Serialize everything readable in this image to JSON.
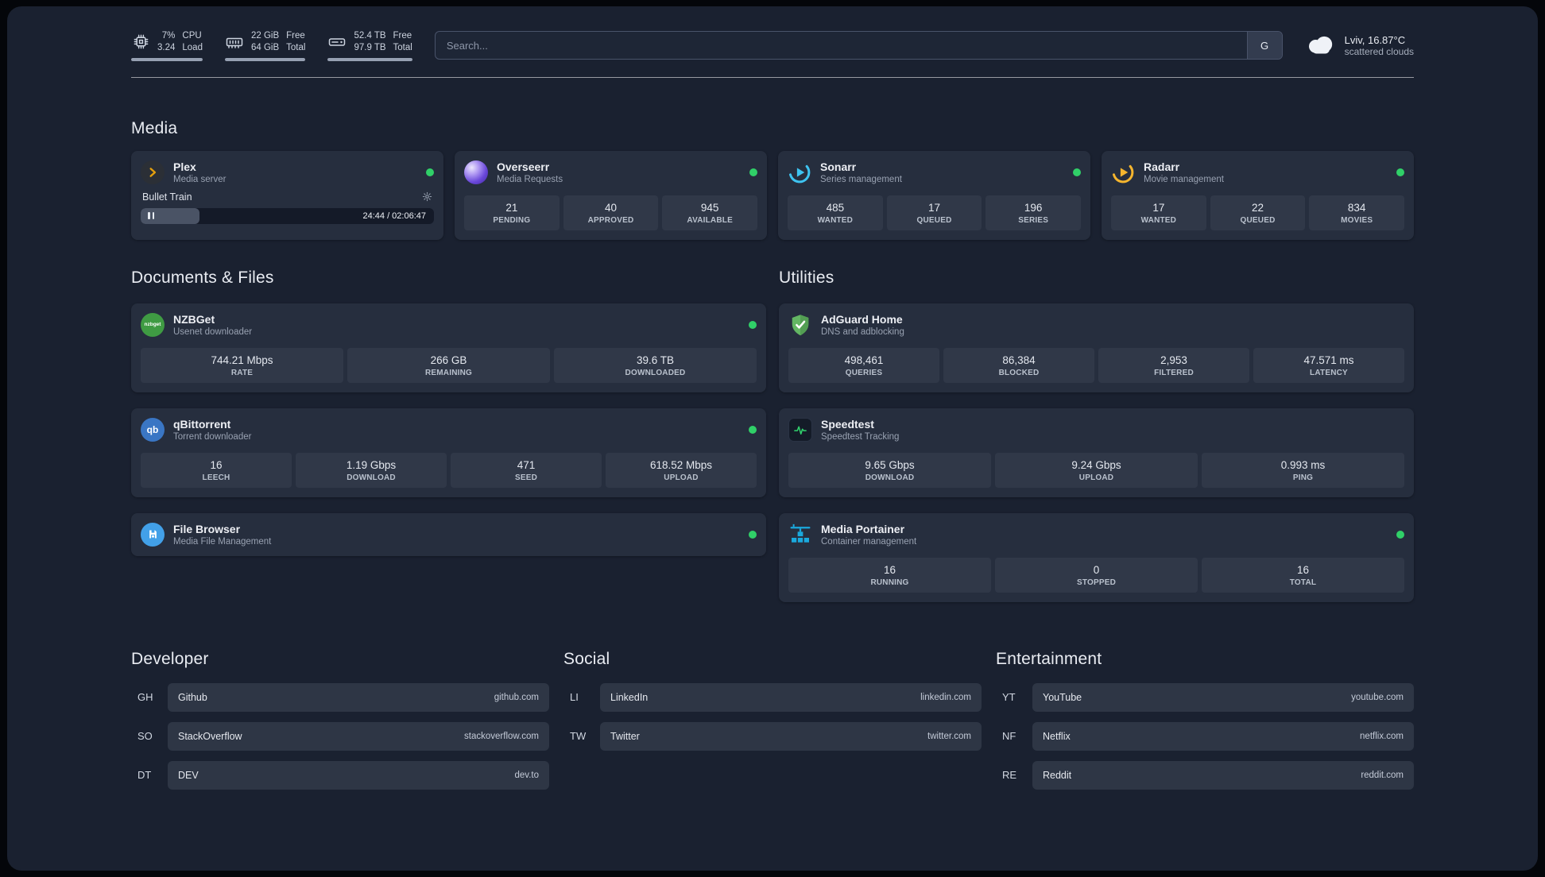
{
  "topbar": {
    "cpu": {
      "value1": "7%",
      "value2": "3.24",
      "label1": "CPU",
      "label2": "Load"
    },
    "memory": {
      "value1": "22 GiB",
      "value2": "64 GiB",
      "label1": "Free",
      "label2": "Total"
    },
    "disk": {
      "value1": "52.4 TB",
      "value2": "97.9 TB",
      "label1": "Free",
      "label2": "Total"
    },
    "search": {
      "placeholder": "Search...",
      "button_label": "G"
    },
    "weather": {
      "location": "Lviv, 16.87°C",
      "condition": "scattered clouds"
    }
  },
  "sections": {
    "media": {
      "heading": "Media",
      "plex": {
        "title": "Plex",
        "subtitle": "Media server",
        "now_playing": {
          "track": "Bullet Train",
          "time": "24:44 / 02:06:47"
        }
      },
      "overseerr": {
        "title": "Overseerr",
        "subtitle": "Media Requests",
        "stats": [
          {
            "value": "21",
            "label": "PENDING"
          },
          {
            "value": "40",
            "label": "APPROVED"
          },
          {
            "value": "945",
            "label": "AVAILABLE"
          }
        ]
      },
      "sonarr": {
        "title": "Sonarr",
        "subtitle": "Series management",
        "stats": [
          {
            "value": "485",
            "label": "WANTED"
          },
          {
            "value": "17",
            "label": "QUEUED"
          },
          {
            "value": "196",
            "label": "SERIES"
          }
        ]
      },
      "radarr": {
        "title": "Radarr",
        "subtitle": "Movie management",
        "stats": [
          {
            "value": "17",
            "label": "WANTED"
          },
          {
            "value": "22",
            "label": "QUEUED"
          },
          {
            "value": "834",
            "label": "MOVIES"
          }
        ]
      }
    },
    "docs": {
      "heading": "Documents & Files",
      "nzbget": {
        "title": "NZBGet",
        "subtitle": "Usenet downloader",
        "icon_text": "nzbget",
        "stats": [
          {
            "value": "744.21 Mbps",
            "label": "RATE"
          },
          {
            "value": "266 GB",
            "label": "REMAINING"
          },
          {
            "value": "39.6 TB",
            "label": "DOWNLOADED"
          }
        ]
      },
      "qbittorrent": {
        "title": "qBittorrent",
        "subtitle": "Torrent downloader",
        "icon_text": "qb",
        "stats": [
          {
            "value": "16",
            "label": "LEECH"
          },
          {
            "value": "1.19 Gbps",
            "label": "DOWNLOAD"
          },
          {
            "value": "471",
            "label": "SEED"
          },
          {
            "value": "618.52 Mbps",
            "label": "UPLOAD"
          }
        ]
      },
      "filebrowser": {
        "title": "File Browser",
        "subtitle": "Media File Management"
      }
    },
    "utils": {
      "heading": "Utilities",
      "adguard": {
        "title": "AdGuard Home",
        "subtitle": "DNS and adblocking",
        "stats": [
          {
            "value": "498,461",
            "label": "QUERIES"
          },
          {
            "value": "86,384",
            "label": "BLOCKED"
          },
          {
            "value": "2,953",
            "label": "FILTERED"
          },
          {
            "value": "47.571 ms",
            "label": "LATENCY"
          }
        ]
      },
      "speedtest": {
        "title": "Speedtest",
        "subtitle": "Speedtest Tracking",
        "stats": [
          {
            "value": "9.65 Gbps",
            "label": "DOWNLOAD"
          },
          {
            "value": "9.24 Gbps",
            "label": "UPLOAD"
          },
          {
            "value": "0.993 ms",
            "label": "PING"
          }
        ]
      },
      "portainer": {
        "title": "Media Portainer",
        "subtitle": "Container management",
        "stats": [
          {
            "value": "16",
            "label": "RUNNING"
          },
          {
            "value": "0",
            "label": "STOPPED"
          },
          {
            "value": "16",
            "label": "TOTAL"
          }
        ]
      }
    }
  },
  "bookmarks": {
    "developer": {
      "heading": "Developer",
      "items": [
        {
          "abbr": "GH",
          "name": "Github",
          "domain": "github.com"
        },
        {
          "abbr": "SO",
          "name": "StackOverflow",
          "domain": "stackoverflow.com"
        },
        {
          "abbr": "DT",
          "name": "DEV",
          "domain": "dev.to"
        }
      ]
    },
    "social": {
      "heading": "Social",
      "items": [
        {
          "abbr": "LI",
          "name": "LinkedIn",
          "domain": "linkedin.com"
        },
        {
          "abbr": "TW",
          "name": "Twitter",
          "domain": "twitter.com"
        }
      ]
    },
    "entertainment": {
      "heading": "Entertainment",
      "items": [
        {
          "abbr": "YT",
          "name": "YouTube",
          "domain": "youtube.com"
        },
        {
          "abbr": "NF",
          "name": "Netflix",
          "domain": "netflix.com"
        },
        {
          "abbr": "RE",
          "name": "Reddit",
          "domain": "reddit.com"
        }
      ]
    }
  },
  "colors": {
    "status_green": "#30d068",
    "plex_amber": "#e5a00d",
    "overseerr_purple": "#6a48da",
    "sonarr_blue": "#3ec3f0",
    "radarr_yellow": "#f5b52e",
    "nzbget_green": "#3f9b43",
    "qbittorrent_blue": "#3a76c4",
    "filebrowser_blue": "#42a0e8",
    "adguard_green": "#63b663",
    "speedtest_green": "#31d26d",
    "portainer_blue": "#1aa9dd"
  }
}
